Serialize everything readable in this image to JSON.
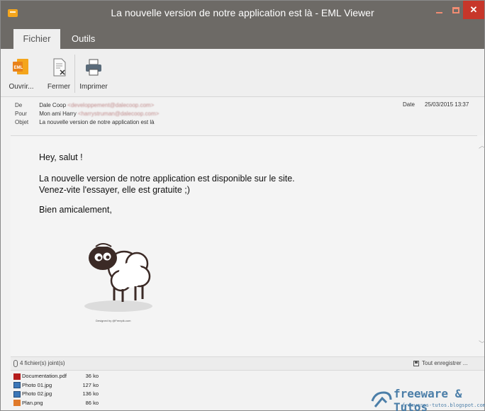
{
  "window": {
    "title": "La nouvelle version de notre application est là - EML Viewer",
    "accent_color": "#6d6a66",
    "close_color": "#c7362a"
  },
  "tabs": [
    {
      "label": "Fichier",
      "active": true
    },
    {
      "label": "Outils",
      "active": false
    }
  ],
  "ribbon": {
    "open_label": "Ouvrir...",
    "close_label": "Fermer",
    "print_label": "Imprimer"
  },
  "header": {
    "from_label": "De",
    "from_name": "Dale Coop",
    "from_email": "<developpement@dalecoop.com>",
    "to_label": "Pour",
    "to_name": "Mon ami Harry",
    "to_email": "<harrystruman@dalecoop.com>",
    "subject_label": "Objet",
    "subject": "La nouvelle version de notre application est là",
    "date_label": "Date",
    "date": "25/03/2015 13:37"
  },
  "body": {
    "greeting": "Hey, salut !",
    "line1": "La nouvelle version de notre application est disponible sur le site.",
    "line2": "Venez-vite l'essayer, elle est gratuite ;)",
    "closing": "Bien amicalement,",
    "image_credit": "Designed by @Freepik.com"
  },
  "attachments": {
    "count_label": "4 fichier(s) joint(s)",
    "save_all_label": "Tout enregistrer ...",
    "items": [
      {
        "name": "Documentation.pdf",
        "size": "36 ko",
        "icon": "pdf-icon"
      },
      {
        "name": "Photo 01.jpg",
        "size": "127 ko",
        "icon": "image-icon"
      },
      {
        "name": "Photo 02.jpg",
        "size": "136 ko",
        "icon": "image-icon"
      },
      {
        "name": "Plan.png",
        "size": "86 ko",
        "icon": "png-icon"
      }
    ]
  },
  "watermark": {
    "title": "freeware & Tutos",
    "url": "freewares-tutos.blogspot.com"
  }
}
